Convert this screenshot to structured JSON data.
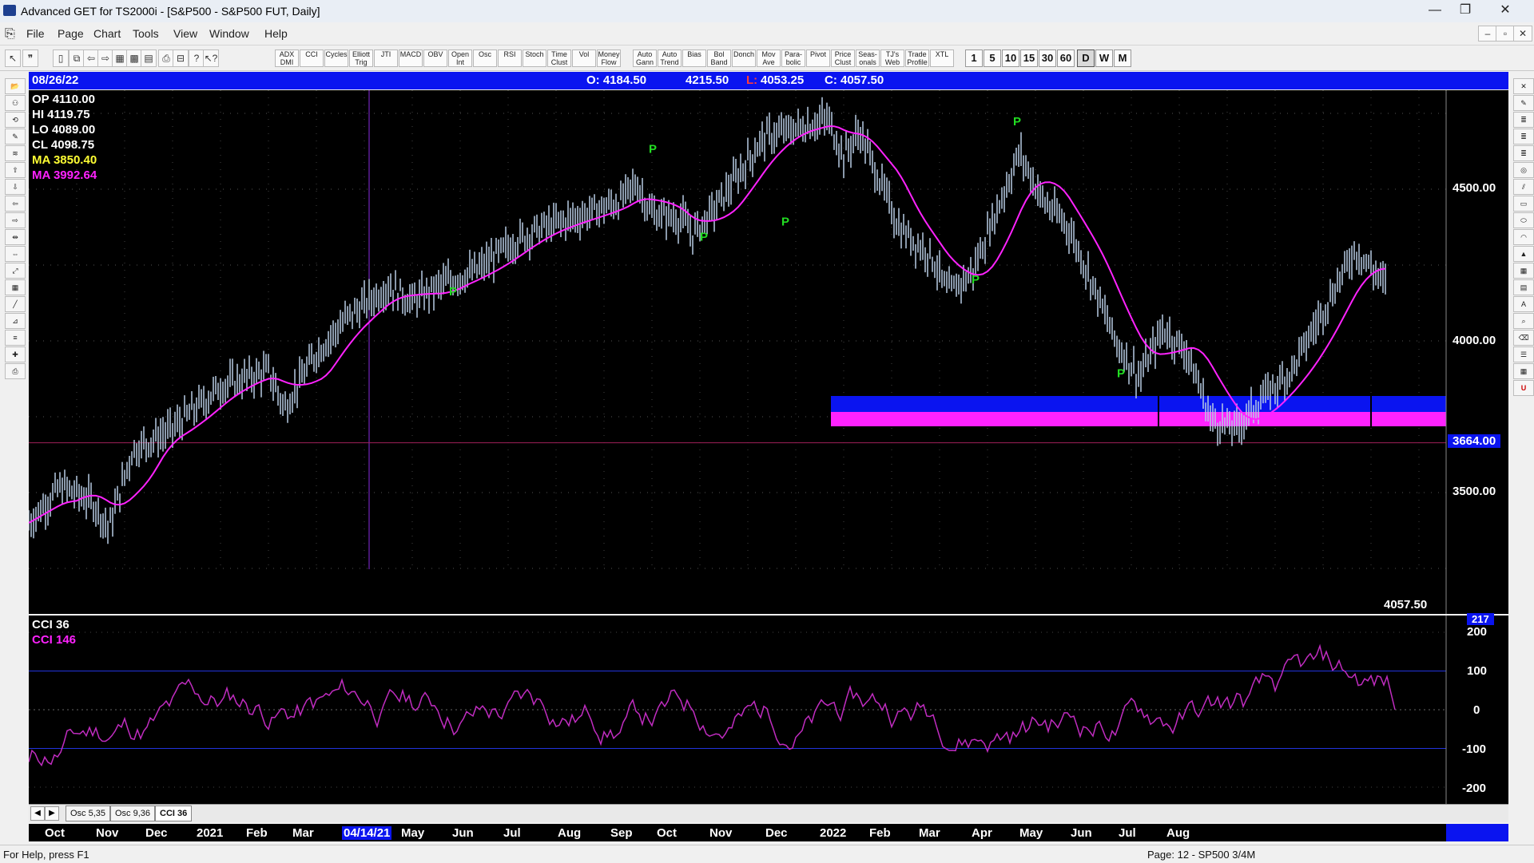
{
  "window": {
    "title": "Advanced GET for TS2000i - [S&P500 - S&P500 FUT, Daily]",
    "minimize": "—",
    "restore": "❐",
    "close": "✕"
  },
  "menu": [
    "File",
    "Page",
    "Chart",
    "Tools",
    "View",
    "Window",
    "Help"
  ],
  "toolbar": {
    "studies": [
      "ADX DMI",
      "CCI",
      "Cycles",
      "Elliott Trig",
      "JTI",
      "MACD",
      "OBV",
      "Open Int",
      "Osc",
      "RSI",
      "Stoch",
      "Time Clust",
      "Vol",
      "Money Flow",
      "Auto Gann",
      "Auto Trend",
      "Bias",
      "Bol Band",
      "Donch",
      "Mov Ave",
      "Para-bolic",
      "Pivot",
      "Price Clust",
      "Seas-onals",
      "TJ's Web",
      "Trade Profile",
      "XTL"
    ],
    "timeframes": [
      "1",
      "5",
      "10",
      "15",
      "30",
      "60",
      "D",
      "W",
      "M"
    ],
    "active_timeframe": "D"
  },
  "infobar": {
    "date": "08/26/22",
    "open": "O: 4184.50",
    "high": "4215.50",
    "low_prefix": "L:",
    "low": "4053.25",
    "close": "C: 4057.50"
  },
  "legend": {
    "op": "OP  4110.00",
    "hi": "HI   4119.75",
    "lo": "LO  4089.00",
    "cl": "CL   4098.75",
    "ma1": "MA  3850.40",
    "ma2": "MA  3992.64"
  },
  "price_axis": {
    "labels": [
      "4500.00",
      "4000.00",
      "3500.00"
    ],
    "marker": "3664.00",
    "last": "4057.50"
  },
  "pivot_label": "P",
  "oscillator": {
    "name": "CCI 36",
    "value_label": "CCI  146",
    "top_value": "217",
    "axis": [
      "200",
      "100",
      "0",
      "-100",
      "-200"
    ]
  },
  "tabs": [
    "Osc 5,35",
    "Osc 9,36",
    "CCI 36"
  ],
  "x_axis": [
    "Oct",
    "Nov",
    "Dec",
    "2021",
    "Feb",
    "Mar",
    "04/14/21",
    "May",
    "Jun",
    "Jul",
    "Aug",
    "Sep",
    "Oct",
    "Nov",
    "Dec",
    "2022",
    "Feb",
    "Mar",
    "Apr",
    "May",
    "Jun",
    "Jul",
    "Aug"
  ],
  "status": {
    "help": "For Help, press F1",
    "page": "Page: 12 - SP500 3/4M"
  },
  "colors": {
    "chart_bg": "#000000",
    "bars": "#b8cce4",
    "ma_fast": "#ff22ff",
    "ma_slow": "#ffff33",
    "pivot": "#22dd22",
    "blue_band": "#0a14f0",
    "magenta_band": "#ff22ff"
  }
}
